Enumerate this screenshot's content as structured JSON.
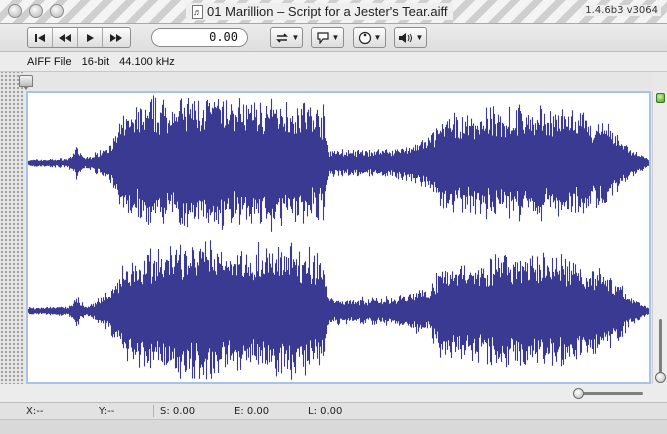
{
  "window": {
    "title": "01 Marillion – Script for a Jester's Tear.aiff",
    "doc_icon": "♬",
    "version": "1.4.6b3 v3064"
  },
  "toolbar": {
    "time_value": "0.00"
  },
  "info": {
    "file_type": "AIFF File",
    "bit_depth": "16-bit",
    "sample_rate": "44.100 kHz"
  },
  "waveform": {
    "color": "#3a3a93",
    "channels": 2
  },
  "status": {
    "x": "X:--",
    "y": "Y:--",
    "s": "S: 0.00",
    "e": "E: 0.00",
    "l": "L: 0.00"
  }
}
